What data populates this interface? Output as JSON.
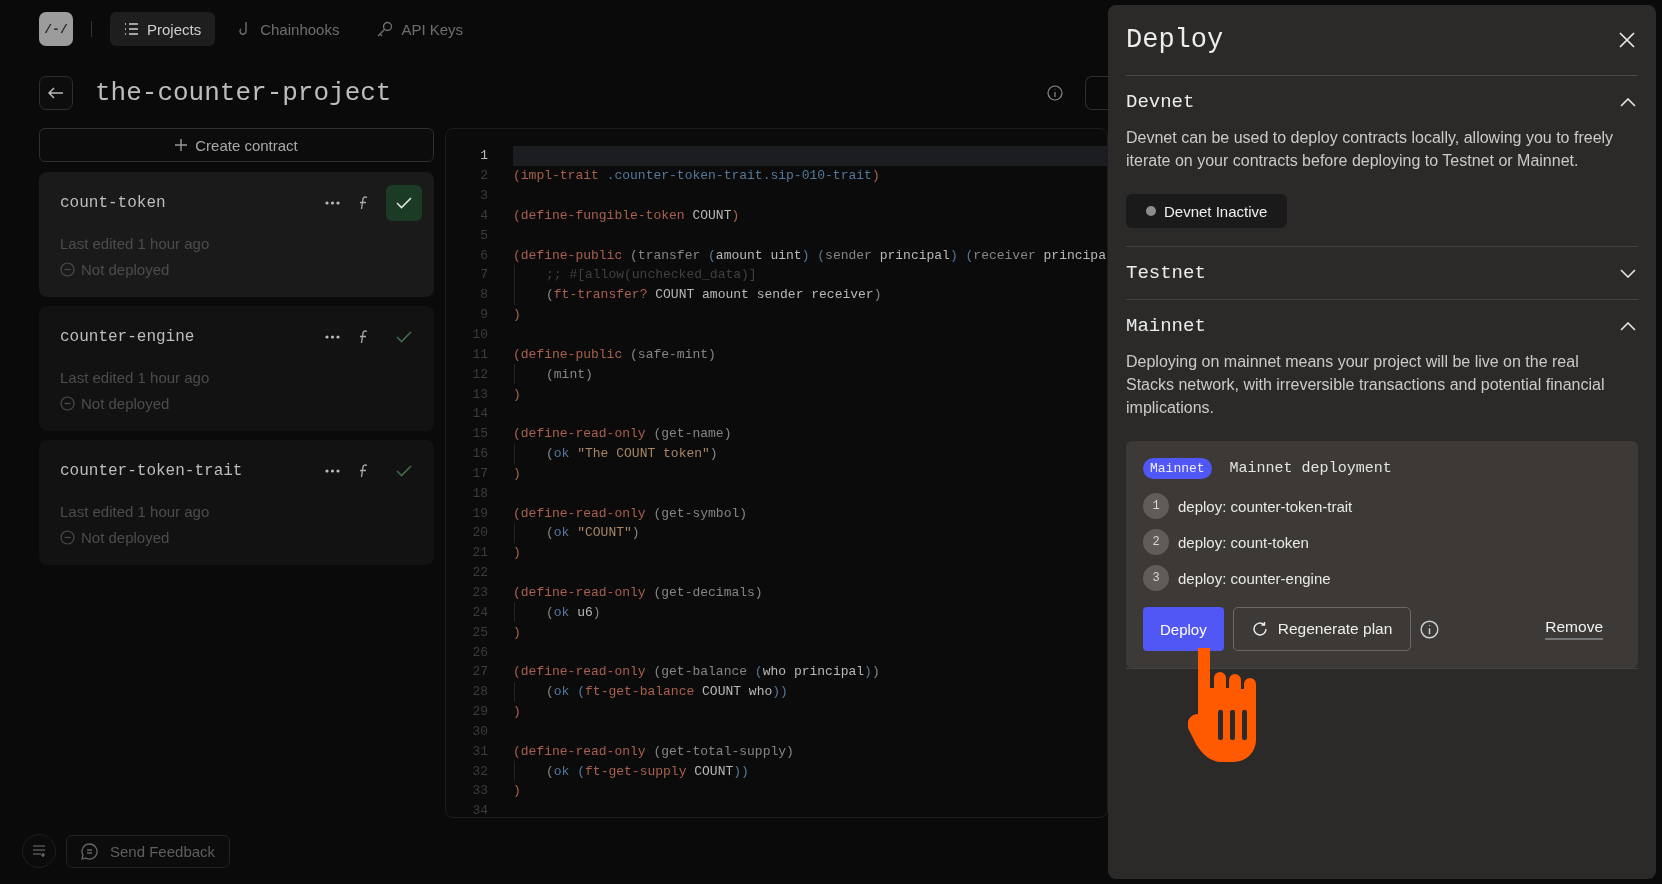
{
  "nav": {
    "logo": "/-/",
    "tabs": [
      {
        "label": "Projects",
        "selected": true,
        "kind": "list"
      },
      {
        "label": "Chainhooks",
        "selected": false,
        "kind": "hook"
      },
      {
        "label": "API Keys",
        "selected": false,
        "kind": "key"
      }
    ]
  },
  "project": {
    "title": "the-counter-project"
  },
  "create_button": "Create contract",
  "contracts": [
    {
      "name": "count-token",
      "edited": "Last edited 1 hour ago",
      "status": "Not deployed",
      "selected": true
    },
    {
      "name": "counter-engine",
      "edited": "Last edited 1 hour ago",
      "status": "Not deployed",
      "selected": false
    },
    {
      "name": "counter-token-trait",
      "edited": "Last edited 1 hour ago",
      "status": "Not deployed",
      "selected": false
    }
  ],
  "code": [
    {
      "n": "1",
      "active": true
    },
    {
      "n": "2",
      "active": false,
      "seg": [
        {
          "kind": "p",
          "text": "(impl-trait "
        },
        {
          "kind": "b",
          "text": ".counter-token-trait.sip-010-trait"
        },
        {
          "kind": "p",
          "text": ")"
        }
      ]
    },
    {
      "n": "3",
      "active": false
    },
    {
      "n": "4",
      "active": false,
      "seg": [
        {
          "kind": "p",
          "text": "(define-fungible-token "
        },
        {
          "kind": "t",
          "text": "COUNT"
        },
        {
          "kind": "p",
          "text": ")"
        }
      ]
    },
    {
      "n": "5",
      "active": false
    },
    {
      "n": "6",
      "active": false,
      "seg": [
        {
          "kind": "p",
          "text": "(define-public "
        },
        {
          "kind": "m",
          "text": "(transfer "
        },
        {
          "kind": "b",
          "text": "("
        },
        {
          "kind": "t",
          "text": "amount uint"
        },
        {
          "kind": "b",
          "text": ") ("
        },
        {
          "kind": "m",
          "text": "sender "
        },
        {
          "kind": "t",
          "text": "principal"
        },
        {
          "kind": "b",
          "text": ") ("
        },
        {
          "kind": "m",
          "text": "receiver "
        },
        {
          "kind": "t",
          "text": "principa"
        }
      ]
    },
    {
      "n": "7",
      "active": false,
      "indent": true,
      "seg": [
        {
          "kind": "c",
          "text": ";; #[allow(unchecked_data)]"
        }
      ]
    },
    {
      "n": "8",
      "active": false,
      "indent": true,
      "seg": [
        {
          "kind": "m",
          "text": "("
        },
        {
          "kind": "p",
          "text": "ft-transfer? "
        },
        {
          "kind": "t",
          "text": "COUNT amount sender receiver"
        },
        {
          "kind": "m",
          "text": ")"
        }
      ]
    },
    {
      "n": "9",
      "active": false,
      "seg": [
        {
          "kind": "p",
          "text": ")"
        }
      ]
    },
    {
      "n": "10",
      "active": false
    },
    {
      "n": "11",
      "active": false,
      "seg": [
        {
          "kind": "p",
          "text": "(define-public "
        },
        {
          "kind": "m",
          "text": "(safe-mint)"
        }
      ]
    },
    {
      "n": "12",
      "active": false,
      "indent": true,
      "seg": [
        {
          "kind": "m",
          "text": "(mint)"
        }
      ]
    },
    {
      "n": "13",
      "active": false,
      "seg": [
        {
          "kind": "p",
          "text": ")"
        }
      ]
    },
    {
      "n": "14",
      "active": false
    },
    {
      "n": "15",
      "active": false,
      "seg": [
        {
          "kind": "p",
          "text": "(define-read-only "
        },
        {
          "kind": "m",
          "text": "(get-name)"
        }
      ]
    },
    {
      "n": "16",
      "active": false,
      "indent": true,
      "seg": [
        {
          "kind": "m",
          "text": "("
        },
        {
          "kind": "b",
          "text": "ok "
        },
        {
          "kind": "s",
          "text": "\"The COUNT token\""
        },
        {
          "kind": "m",
          "text": ")"
        }
      ]
    },
    {
      "n": "17",
      "active": false,
      "seg": [
        {
          "kind": "p",
          "text": ")"
        }
      ]
    },
    {
      "n": "18",
      "active": false
    },
    {
      "n": "19",
      "active": false,
      "seg": [
        {
          "kind": "p",
          "text": "(define-read-only "
        },
        {
          "kind": "m",
          "text": "(get-symbol)"
        }
      ]
    },
    {
      "n": "20",
      "active": false,
      "indent": true,
      "seg": [
        {
          "kind": "m",
          "text": "("
        },
        {
          "kind": "b",
          "text": "ok "
        },
        {
          "kind": "s",
          "text": "\"COUNT\""
        },
        {
          "kind": "m",
          "text": ")"
        }
      ]
    },
    {
      "n": "21",
      "active": false,
      "seg": [
        {
          "kind": "p",
          "text": ")"
        }
      ]
    },
    {
      "n": "22",
      "active": false
    },
    {
      "n": "23",
      "active": false,
      "seg": [
        {
          "kind": "p",
          "text": "(define-read-only "
        },
        {
          "kind": "m",
          "text": "(get-decimals)"
        }
      ]
    },
    {
      "n": "24",
      "active": false,
      "indent": true,
      "seg": [
        {
          "kind": "m",
          "text": "("
        },
        {
          "kind": "b",
          "text": "ok "
        },
        {
          "kind": "t",
          "text": "u6"
        },
        {
          "kind": "m",
          "text": ")"
        }
      ]
    },
    {
      "n": "25",
      "active": false,
      "seg": [
        {
          "kind": "p",
          "text": ")"
        }
      ]
    },
    {
      "n": "26",
      "active": false
    },
    {
      "n": "27",
      "active": false,
      "seg": [
        {
          "kind": "p",
          "text": "(define-read-only "
        },
        {
          "kind": "m",
          "text": "(get-balance "
        },
        {
          "kind": "b",
          "text": "("
        },
        {
          "kind": "t",
          "text": "who principal"
        },
        {
          "kind": "b",
          "text": ")"
        },
        {
          "kind": "m",
          "text": ")"
        }
      ]
    },
    {
      "n": "28",
      "active": false,
      "indent": true,
      "seg": [
        {
          "kind": "m",
          "text": "("
        },
        {
          "kind": "b",
          "text": "ok ("
        },
        {
          "kind": "p",
          "text": "ft-get-balance "
        },
        {
          "kind": "t",
          "text": "COUNT who"
        },
        {
          "kind": "b",
          "text": "))"
        }
      ]
    },
    {
      "n": "29",
      "active": false,
      "seg": [
        {
          "kind": "p",
          "text": ")"
        }
      ]
    },
    {
      "n": "30",
      "active": false
    },
    {
      "n": "31",
      "active": false,
      "seg": [
        {
          "kind": "p",
          "text": "(define-read-only "
        },
        {
          "kind": "m",
          "text": "(get-total-supply)"
        }
      ]
    },
    {
      "n": "32",
      "active": false,
      "indent": true,
      "seg": [
        {
          "kind": "m",
          "text": "("
        },
        {
          "kind": "b",
          "text": "ok ("
        },
        {
          "kind": "p",
          "text": "ft-get-supply "
        },
        {
          "kind": "t",
          "text": "COUNT"
        },
        {
          "kind": "b",
          "text": "))"
        }
      ]
    },
    {
      "n": "33",
      "active": false,
      "seg": [
        {
          "kind": "p",
          "text": ")"
        }
      ]
    },
    {
      "n": "34",
      "active": false
    }
  ],
  "footer": {
    "feedback": "Send Feedback"
  },
  "drawer": {
    "title": "Deploy",
    "sections": [
      {
        "title": "Devnet",
        "expanded": true,
        "kind": "devnet",
        "text": "Devnet can be used to deploy contracts locally, allowing you to freely iterate on your contracts before deploying to Testnet or Mainnet.",
        "status": "Devnet Inactive"
      },
      {
        "title": "Testnet",
        "expanded": false
      },
      {
        "title": "Mainnet",
        "expanded": true,
        "kind": "plan",
        "text": "Deploying on mainnet means your project will be live on the real Stacks network, with irreversible transactions and potential financial implications.",
        "plan": {
          "tag": "Mainnet",
          "title": "Mainnet deployment",
          "steps": [
            {
              "n": "1",
              "label": "deploy: counter-token-trait"
            },
            {
              "n": "2",
              "label": "deploy: count-token"
            },
            {
              "n": "3",
              "label": "deploy: counter-engine"
            }
          ],
          "deploy": "Deploy",
          "regenerate": "Regenerate plan",
          "remove": "Remove"
        }
      }
    ]
  }
}
